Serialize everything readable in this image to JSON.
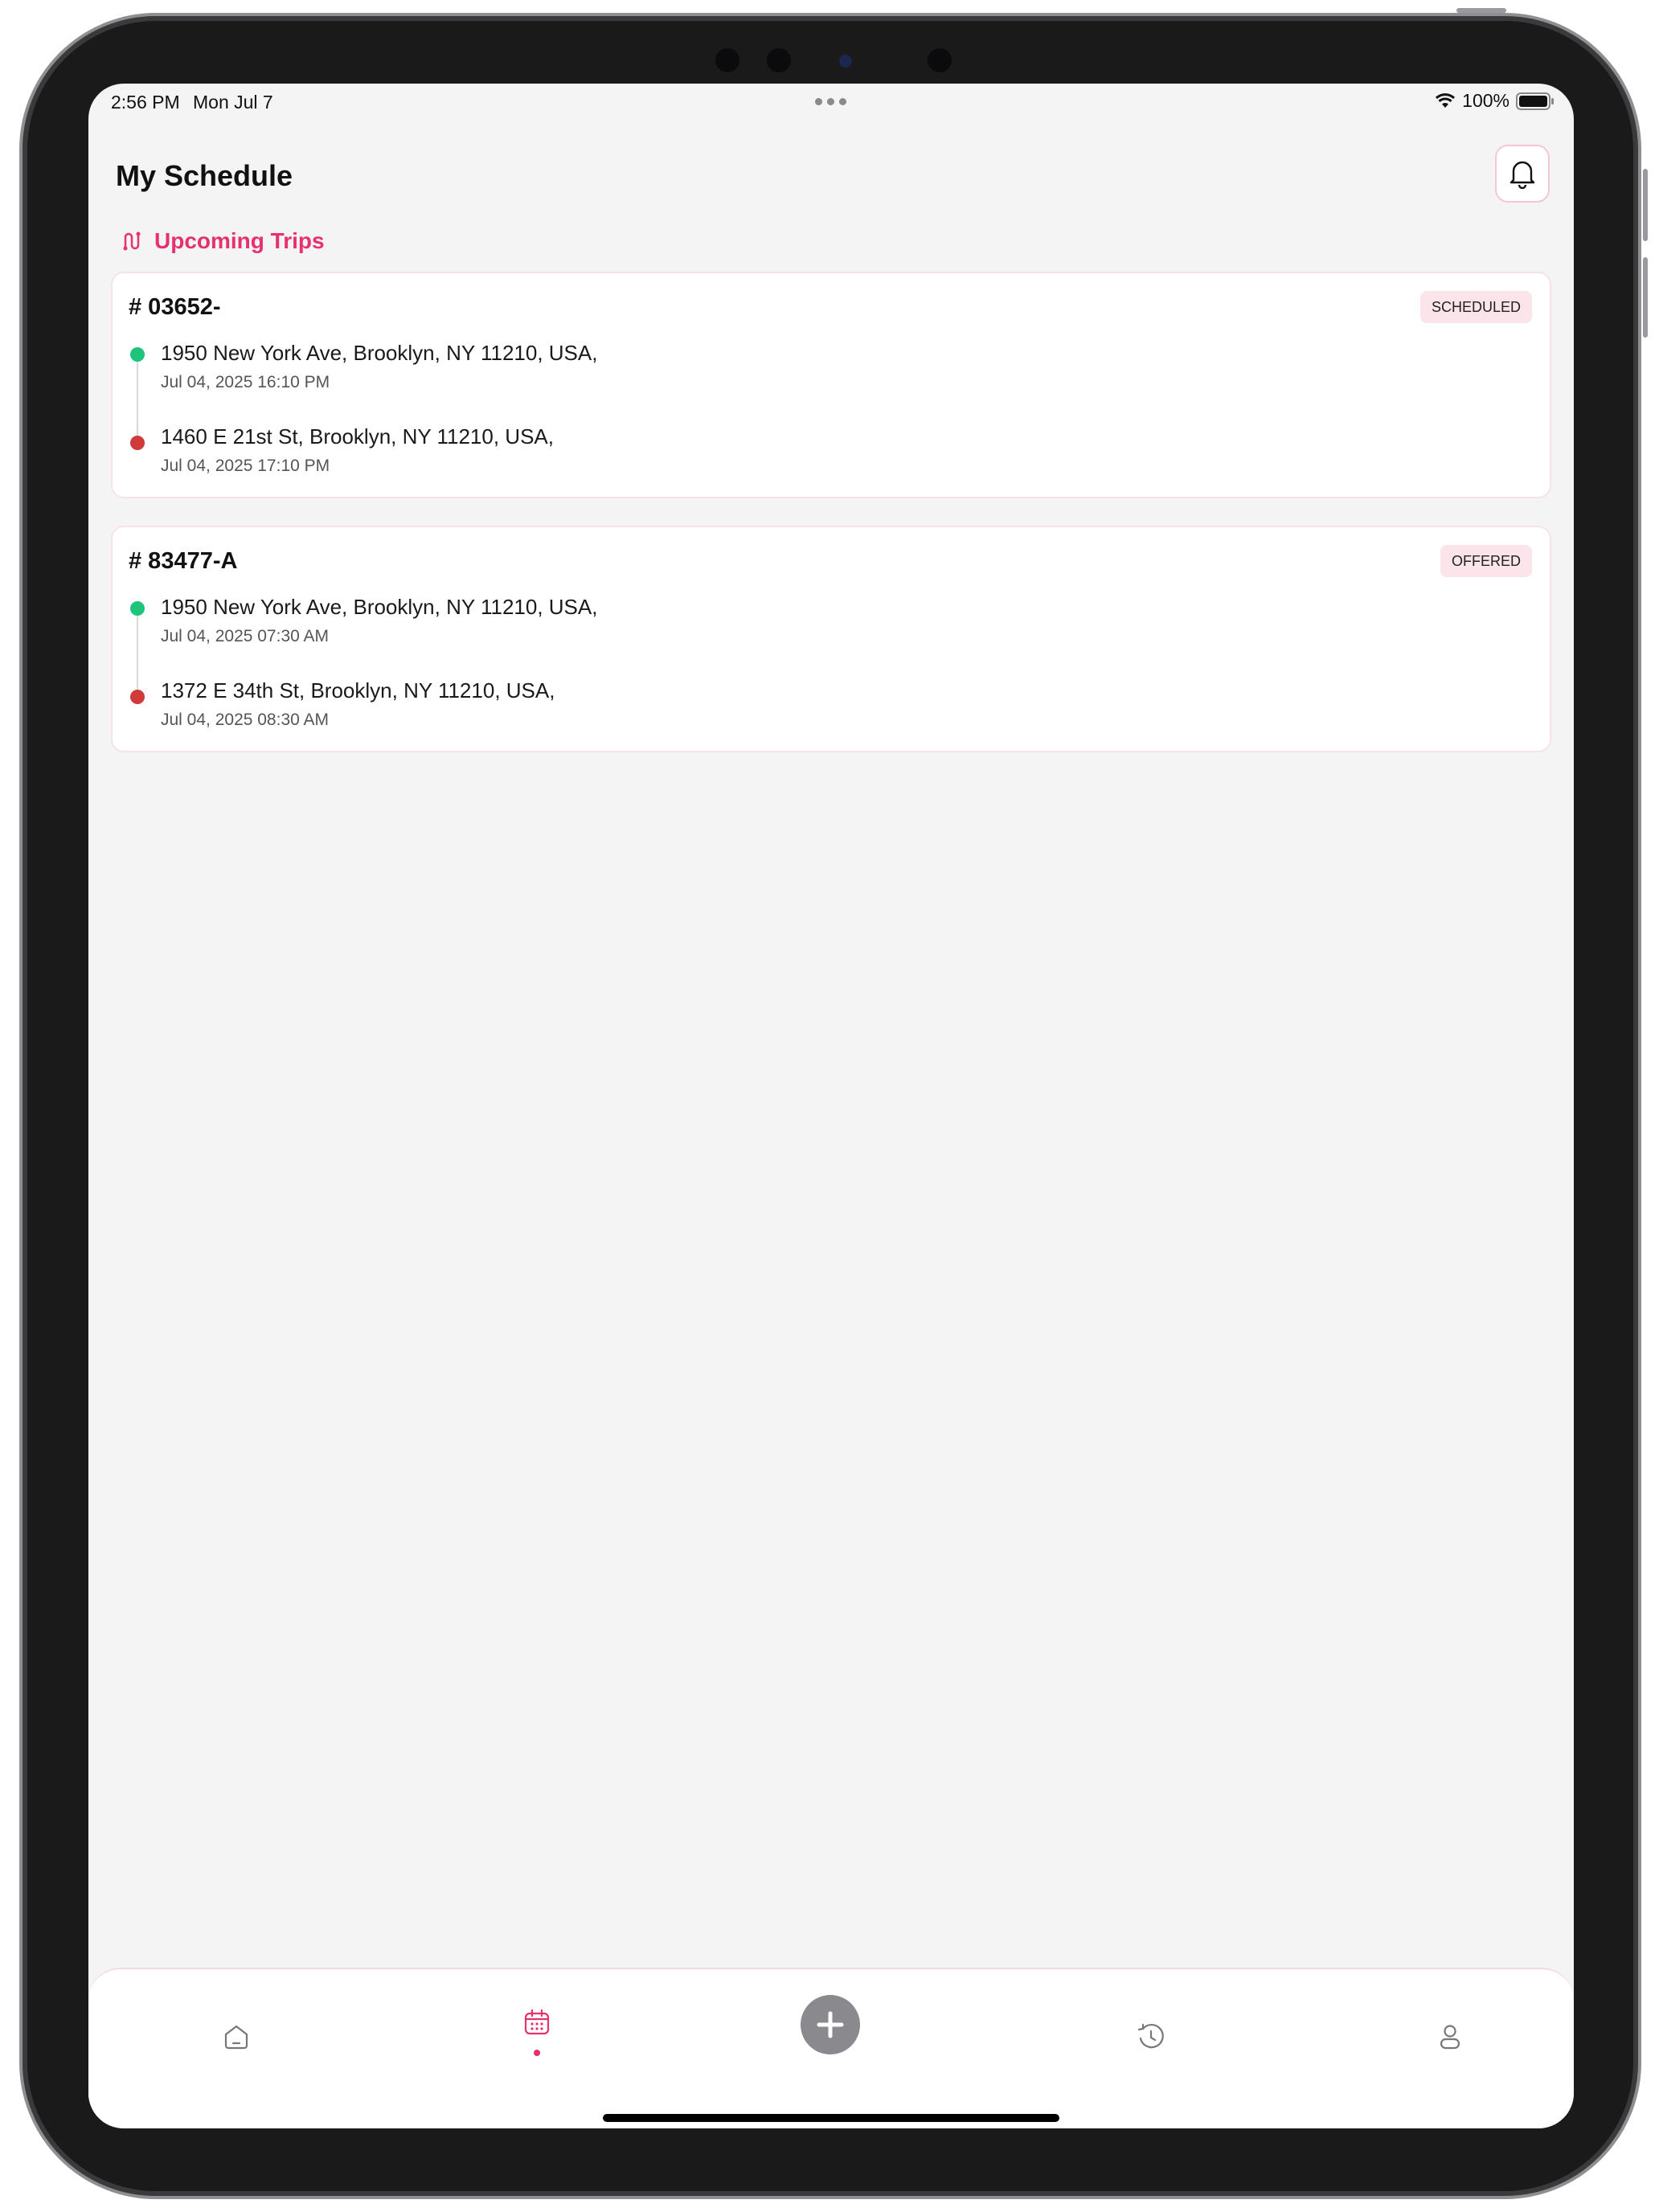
{
  "status_bar": {
    "time": "2:56 PM",
    "date": "Mon Jul 7",
    "battery": "100%"
  },
  "header": {
    "title": "My Schedule",
    "notification_icon": "bell-icon"
  },
  "section": {
    "label": "Upcoming Trips",
    "icon": "route-icon"
  },
  "trips": [
    {
      "id": "# 03652-",
      "status": "SCHEDULED",
      "pickup": {
        "address": "1950 New York Ave, Brooklyn, NY 11210, USA,",
        "time": "Jul 04, 2025 16:10 PM"
      },
      "dropoff": {
        "address": "1460 E 21st St, Brooklyn, NY 11210, USA,",
        "time": "Jul 04, 2025 17:10 PM"
      }
    },
    {
      "id": "# 83477-A",
      "status": "OFFERED",
      "pickup": {
        "address": "1950 New York Ave, Brooklyn, NY 11210, USA,",
        "time": "Jul 04, 2025 07:30 AM"
      },
      "dropoff": {
        "address": "1372 E 34th St, Brooklyn, NY 11210, USA,",
        "time": "Jul 04, 2025 08:30 AM"
      }
    }
  ],
  "tab_bar": {
    "items": [
      {
        "icon": "home-icon",
        "active": false
      },
      {
        "icon": "calendar-icon",
        "active": true
      },
      {
        "icon": "plus-icon",
        "active": false
      },
      {
        "icon": "history-icon",
        "active": false
      },
      {
        "icon": "profile-icon",
        "active": false
      }
    ]
  },
  "colors": {
    "accent": "#e6306f",
    "pickup_dot": "#1ec47c",
    "dropoff_dot": "#d03a3a",
    "badge_bg": "#fbe4ea"
  }
}
